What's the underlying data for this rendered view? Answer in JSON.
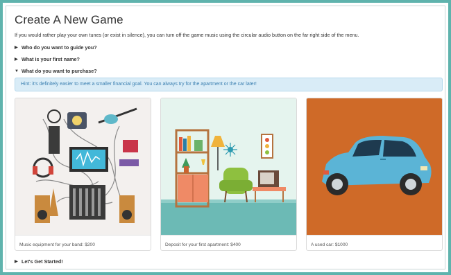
{
  "page": {
    "title": "Create A New Game",
    "intro": "If you would rather play your own tunes (or exist in silence), you can turn off the game music using the circular audio button on the far right side of the menu."
  },
  "accordion": [
    {
      "label": "Who do you want to guide you?",
      "expanded": false
    },
    {
      "label": "What is your first name?",
      "expanded": false
    },
    {
      "label": "What do you want to purchase?",
      "expanded": true
    }
  ],
  "hint": "Hint: it's definitely easier to meet a smaller financial goal. You can always try for the apartment or the car later!",
  "cards": [
    {
      "caption": "Music equipment for your band: $200",
      "bg": "#f3f0ee"
    },
    {
      "caption": "Deposit for your first apartment: $400",
      "bg": "#e5f4ee"
    },
    {
      "caption": "A used car: $1000",
      "bg": "#cf6a28"
    }
  ],
  "start": {
    "label": "Let's Get Started!",
    "expanded": false
  },
  "colors": {
    "frame": "#5fb3ad",
    "hint_bg": "#d9ecf7",
    "hint_text": "#3b7fb0"
  }
}
